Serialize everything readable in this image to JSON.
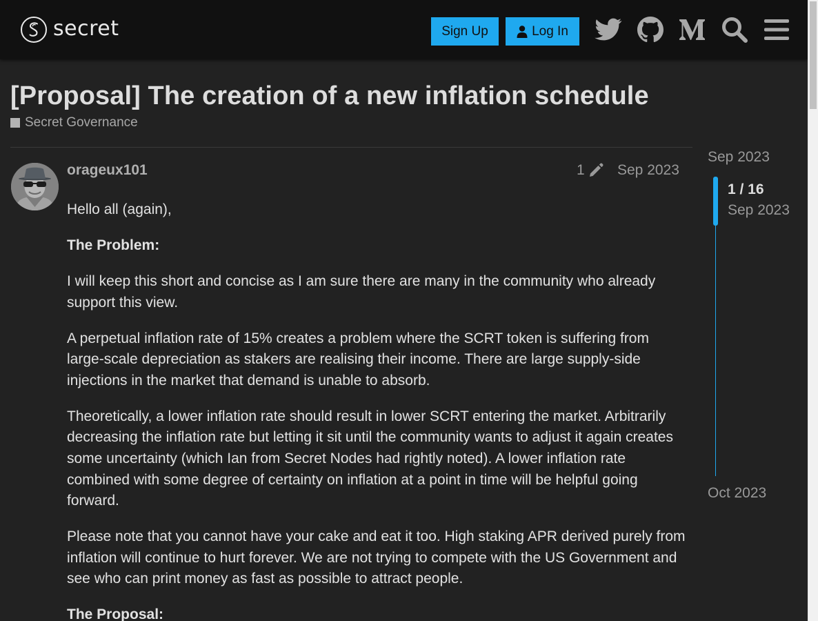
{
  "header": {
    "logo_text": "secret",
    "signup_label": "Sign Up",
    "login_label": "Log In",
    "icons": [
      "twitter-icon",
      "github-icon",
      "medium-icon",
      "search-icon",
      "hamburger-menu-icon"
    ]
  },
  "topic": {
    "title": "[Proposal] The creation of a new inflation schedule",
    "category": "Secret Governance"
  },
  "post": {
    "username": "orageux101",
    "edit_count": "1",
    "date": "Sep 2023",
    "paragraphs": [
      {
        "text": "Hello all (again),",
        "bold": false
      },
      {
        "text": "The Problem:",
        "bold": true
      },
      {
        "text": "I will keep this short and concise as I am sure there are many in the community who already support this view.",
        "bold": false
      },
      {
        "text": "A perpetual inflation rate of 15% creates a problem where the SCRT token is suffering from large-scale depreciation as stakers are realising their income. There are large supply-side injections in the market that demand is unable to absorb.",
        "bold": false
      },
      {
        "text": "Theoretically, a lower inflation rate should result in lower SCRT entering the market. Arbitrarily decreasing the inflation rate but letting it sit until the community wants to adjust it again creates some uncertainty (which Ian from Secret Nodes had rightly noted). A lower inflation rate combined with some degree of certainty on inflation at a point in time will be helpful going forward.",
        "bold": false
      },
      {
        "text": "Please note that you cannot have your cake and eat it too. High staking APR derived purely from inflation will continue to hurt forever. We are not trying to compete with the US Government and see who can print money as fast as possible to attract people.",
        "bold": false
      },
      {
        "text": "The Proposal:",
        "bold": true
      }
    ]
  },
  "timeline": {
    "start_date": "Sep 2023",
    "position": "1 / 16",
    "current_date": "Sep 2023",
    "end_date": "Oct 2023",
    "progress_fraction": 0.0625
  },
  "colors": {
    "accent": "#1fa9ef",
    "background": "#222222",
    "header_bg": "#111111"
  }
}
